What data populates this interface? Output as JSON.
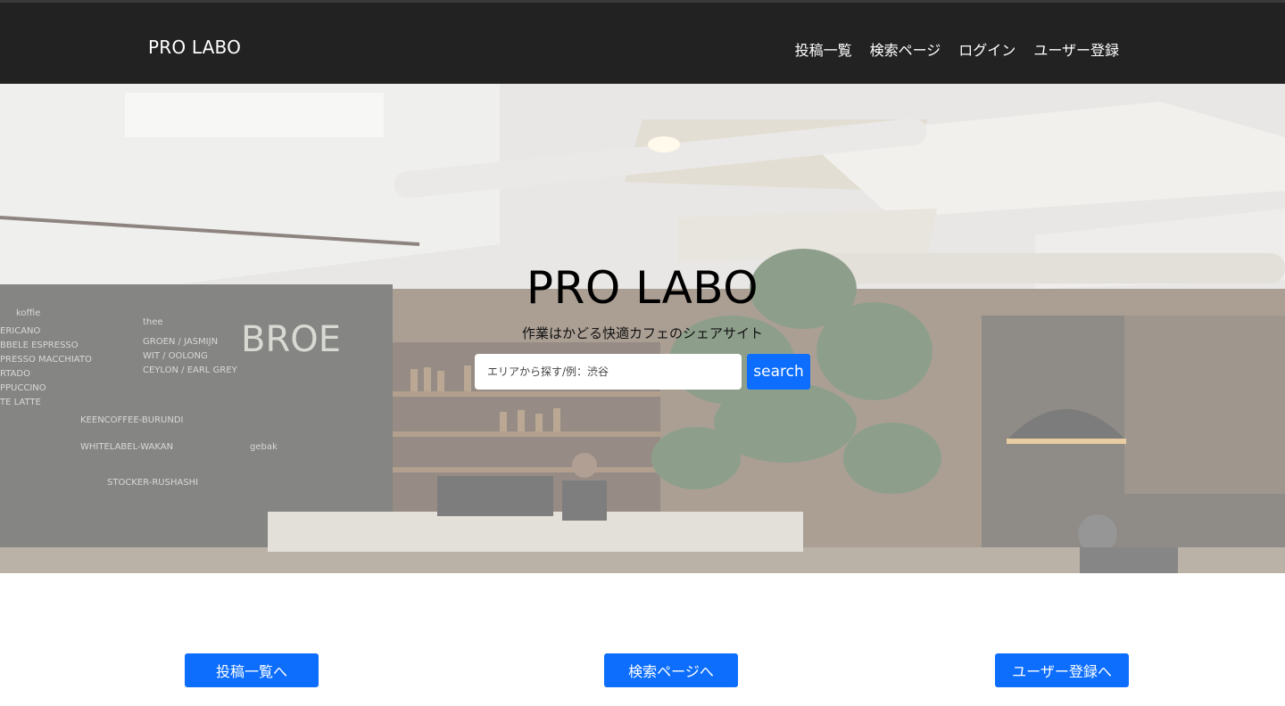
{
  "header": {
    "brand": "PRO LABO",
    "nav": [
      {
        "label": "投稿一覧"
      },
      {
        "label": "検索ページ"
      },
      {
        "label": "ログイン"
      },
      {
        "label": "ユーザー登録"
      }
    ]
  },
  "hero": {
    "title": "PRO LABO",
    "subtitle": "作業はかどる快適カフェのシェアサイト",
    "search": {
      "placeholder": "エリアから探す/例：渋谷",
      "value": "",
      "button_label": "search"
    }
  },
  "actions": {
    "posts_label": "投稿一覧へ",
    "search_label": "検索ページへ",
    "register_label": "ユーザー登録へ"
  },
  "colors": {
    "header_bg": "#222222",
    "accent": "#0d6efd",
    "text_on_dark": "#ffffff"
  }
}
